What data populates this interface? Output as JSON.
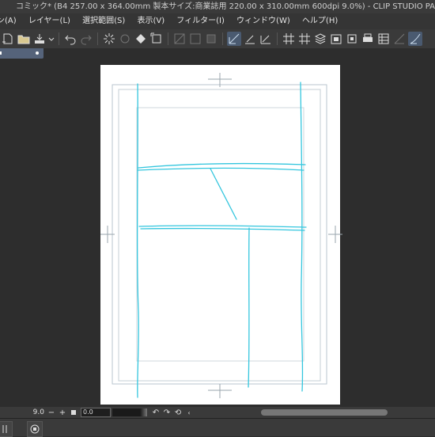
{
  "window": {
    "title": "コミック* (B4 257.00 x 364.00mm 製本サイズ:商業誌用 220.00 x 310.00mm 600dpi 9.0%)  - CLIP STUDIO PAINT EX"
  },
  "menu": {
    "items": [
      "ン(A)",
      "レイヤー(L)",
      "選択範囲(S)",
      "表示(V)",
      "フィルター(I)",
      "ウィンドウ(W)",
      "ヘルプ(H)"
    ]
  },
  "status": {
    "zoom": "9.0",
    "rotation": "0.0"
  },
  "colors": {
    "sketch": "#34c6de",
    "frame": "#b9c6cf",
    "accent_tab": "#55637a"
  }
}
